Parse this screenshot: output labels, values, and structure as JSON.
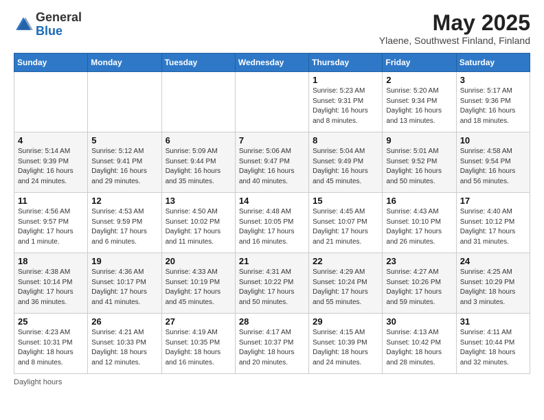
{
  "logo": {
    "general": "General",
    "blue": "Blue"
  },
  "title": "May 2025",
  "subtitle": "Ylaene, Southwest Finland, Finland",
  "weekdays": [
    "Sunday",
    "Monday",
    "Tuesday",
    "Wednesday",
    "Thursday",
    "Friday",
    "Saturday"
  ],
  "footer": "Daylight hours",
  "weeks": [
    [
      {
        "day": "",
        "sunrise": "",
        "sunset": "",
        "daylight": ""
      },
      {
        "day": "",
        "sunrise": "",
        "sunset": "",
        "daylight": ""
      },
      {
        "day": "",
        "sunrise": "",
        "sunset": "",
        "daylight": ""
      },
      {
        "day": "",
        "sunrise": "",
        "sunset": "",
        "daylight": ""
      },
      {
        "day": "1",
        "sunrise": "Sunrise: 5:23 AM",
        "sunset": "Sunset: 9:31 PM",
        "daylight": "Daylight: 16 hours and 8 minutes."
      },
      {
        "day": "2",
        "sunrise": "Sunrise: 5:20 AM",
        "sunset": "Sunset: 9:34 PM",
        "daylight": "Daylight: 16 hours and 13 minutes."
      },
      {
        "day": "3",
        "sunrise": "Sunrise: 5:17 AM",
        "sunset": "Sunset: 9:36 PM",
        "daylight": "Daylight: 16 hours and 18 minutes."
      }
    ],
    [
      {
        "day": "4",
        "sunrise": "Sunrise: 5:14 AM",
        "sunset": "Sunset: 9:39 PM",
        "daylight": "Daylight: 16 hours and 24 minutes."
      },
      {
        "day": "5",
        "sunrise": "Sunrise: 5:12 AM",
        "sunset": "Sunset: 9:41 PM",
        "daylight": "Daylight: 16 hours and 29 minutes."
      },
      {
        "day": "6",
        "sunrise": "Sunrise: 5:09 AM",
        "sunset": "Sunset: 9:44 PM",
        "daylight": "Daylight: 16 hours and 35 minutes."
      },
      {
        "day": "7",
        "sunrise": "Sunrise: 5:06 AM",
        "sunset": "Sunset: 9:47 PM",
        "daylight": "Daylight: 16 hours and 40 minutes."
      },
      {
        "day": "8",
        "sunrise": "Sunrise: 5:04 AM",
        "sunset": "Sunset: 9:49 PM",
        "daylight": "Daylight: 16 hours and 45 minutes."
      },
      {
        "day": "9",
        "sunrise": "Sunrise: 5:01 AM",
        "sunset": "Sunset: 9:52 PM",
        "daylight": "Daylight: 16 hours and 50 minutes."
      },
      {
        "day": "10",
        "sunrise": "Sunrise: 4:58 AM",
        "sunset": "Sunset: 9:54 PM",
        "daylight": "Daylight: 16 hours and 56 minutes."
      }
    ],
    [
      {
        "day": "11",
        "sunrise": "Sunrise: 4:56 AM",
        "sunset": "Sunset: 9:57 PM",
        "daylight": "Daylight: 17 hours and 1 minute."
      },
      {
        "day": "12",
        "sunrise": "Sunrise: 4:53 AM",
        "sunset": "Sunset: 9:59 PM",
        "daylight": "Daylight: 17 hours and 6 minutes."
      },
      {
        "day": "13",
        "sunrise": "Sunrise: 4:50 AM",
        "sunset": "Sunset: 10:02 PM",
        "daylight": "Daylight: 17 hours and 11 minutes."
      },
      {
        "day": "14",
        "sunrise": "Sunrise: 4:48 AM",
        "sunset": "Sunset: 10:05 PM",
        "daylight": "Daylight: 17 hours and 16 minutes."
      },
      {
        "day": "15",
        "sunrise": "Sunrise: 4:45 AM",
        "sunset": "Sunset: 10:07 PM",
        "daylight": "Daylight: 17 hours and 21 minutes."
      },
      {
        "day": "16",
        "sunrise": "Sunrise: 4:43 AM",
        "sunset": "Sunset: 10:10 PM",
        "daylight": "Daylight: 17 hours and 26 minutes."
      },
      {
        "day": "17",
        "sunrise": "Sunrise: 4:40 AM",
        "sunset": "Sunset: 10:12 PM",
        "daylight": "Daylight: 17 hours and 31 minutes."
      }
    ],
    [
      {
        "day": "18",
        "sunrise": "Sunrise: 4:38 AM",
        "sunset": "Sunset: 10:14 PM",
        "daylight": "Daylight: 17 hours and 36 minutes."
      },
      {
        "day": "19",
        "sunrise": "Sunrise: 4:36 AM",
        "sunset": "Sunset: 10:17 PM",
        "daylight": "Daylight: 17 hours and 41 minutes."
      },
      {
        "day": "20",
        "sunrise": "Sunrise: 4:33 AM",
        "sunset": "Sunset: 10:19 PM",
        "daylight": "Daylight: 17 hours and 45 minutes."
      },
      {
        "day": "21",
        "sunrise": "Sunrise: 4:31 AM",
        "sunset": "Sunset: 10:22 PM",
        "daylight": "Daylight: 17 hours and 50 minutes."
      },
      {
        "day": "22",
        "sunrise": "Sunrise: 4:29 AM",
        "sunset": "Sunset: 10:24 PM",
        "daylight": "Daylight: 17 hours and 55 minutes."
      },
      {
        "day": "23",
        "sunrise": "Sunrise: 4:27 AM",
        "sunset": "Sunset: 10:26 PM",
        "daylight": "Daylight: 17 hours and 59 minutes."
      },
      {
        "day": "24",
        "sunrise": "Sunrise: 4:25 AM",
        "sunset": "Sunset: 10:29 PM",
        "daylight": "Daylight: 18 hours and 3 minutes."
      }
    ],
    [
      {
        "day": "25",
        "sunrise": "Sunrise: 4:23 AM",
        "sunset": "Sunset: 10:31 PM",
        "daylight": "Daylight: 18 hours and 8 minutes."
      },
      {
        "day": "26",
        "sunrise": "Sunrise: 4:21 AM",
        "sunset": "Sunset: 10:33 PM",
        "daylight": "Daylight: 18 hours and 12 minutes."
      },
      {
        "day": "27",
        "sunrise": "Sunrise: 4:19 AM",
        "sunset": "Sunset: 10:35 PM",
        "daylight": "Daylight: 18 hours and 16 minutes."
      },
      {
        "day": "28",
        "sunrise": "Sunrise: 4:17 AM",
        "sunset": "Sunset: 10:37 PM",
        "daylight": "Daylight: 18 hours and 20 minutes."
      },
      {
        "day": "29",
        "sunrise": "Sunrise: 4:15 AM",
        "sunset": "Sunset: 10:39 PM",
        "daylight": "Daylight: 18 hours and 24 minutes."
      },
      {
        "day": "30",
        "sunrise": "Sunrise: 4:13 AM",
        "sunset": "Sunset: 10:42 PM",
        "daylight": "Daylight: 18 hours and 28 minutes."
      },
      {
        "day": "31",
        "sunrise": "Sunrise: 4:11 AM",
        "sunset": "Sunset: 10:44 PM",
        "daylight": "Daylight: 18 hours and 32 minutes."
      }
    ]
  ]
}
